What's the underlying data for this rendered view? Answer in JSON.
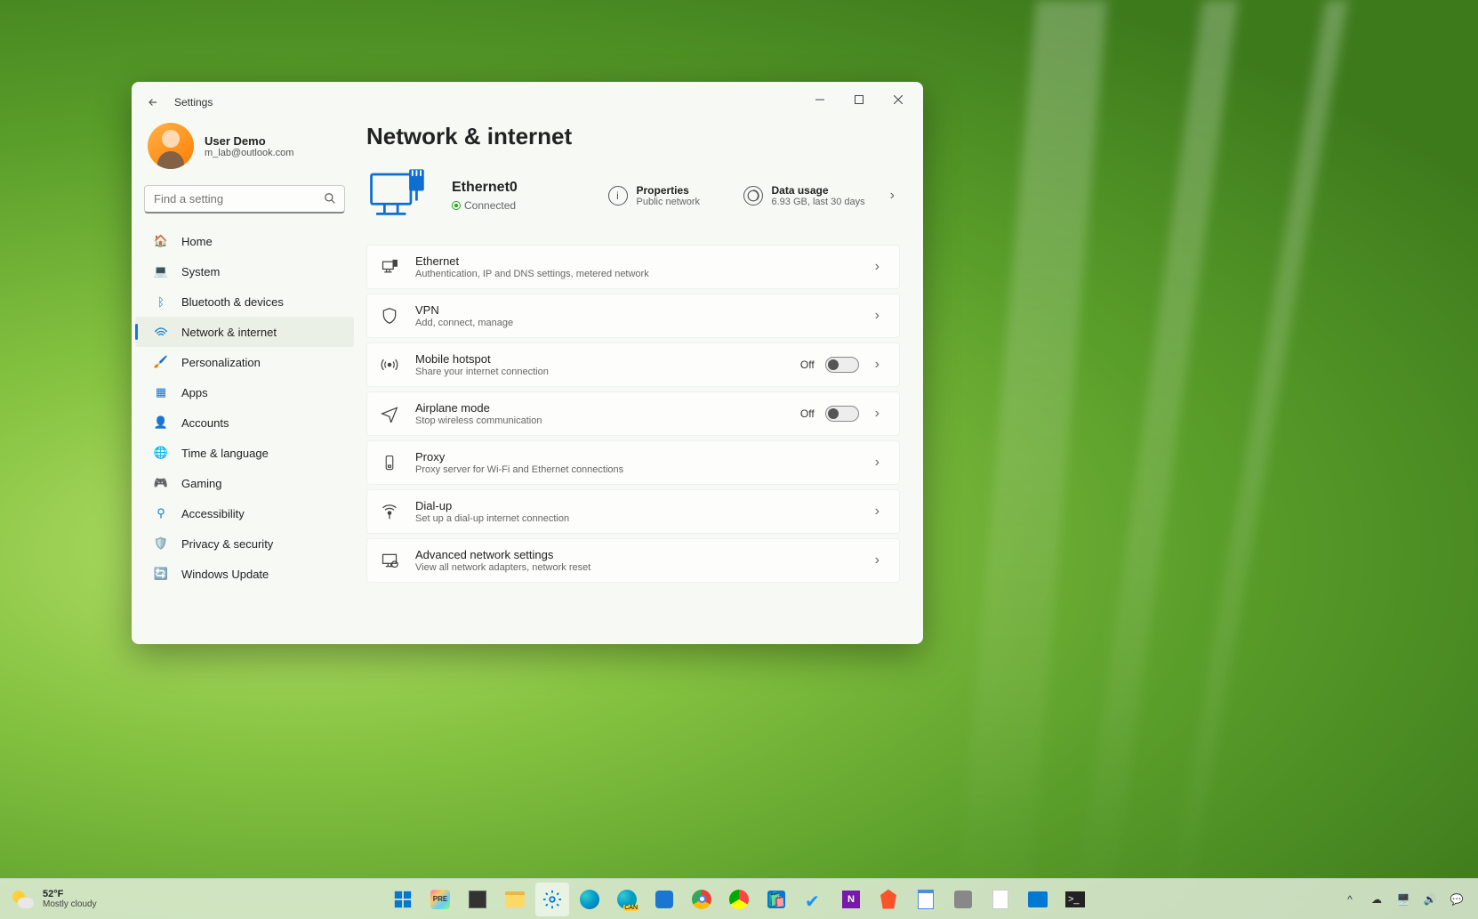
{
  "window": {
    "title": "Settings",
    "user_name": "User Demo",
    "user_email": "m_lab@outlook.com",
    "search_placeholder": "Find a setting"
  },
  "sidebar": {
    "items": [
      {
        "label": "Home"
      },
      {
        "label": "System"
      },
      {
        "label": "Bluetooth & devices"
      },
      {
        "label": "Network & internet"
      },
      {
        "label": "Personalization"
      },
      {
        "label": "Apps"
      },
      {
        "label": "Accounts"
      },
      {
        "label": "Time & language"
      },
      {
        "label": "Gaming"
      },
      {
        "label": "Accessibility"
      },
      {
        "label": "Privacy & security"
      },
      {
        "label": "Windows Update"
      }
    ]
  },
  "page": {
    "title": "Network & internet",
    "connection_name": "Ethernet0",
    "connection_status": "Connected",
    "properties_label": "Properties",
    "properties_sub": "Public network",
    "data_usage_label": "Data usage",
    "data_usage_sub": "6.93 GB, last 30 days"
  },
  "cards": [
    {
      "title": "Ethernet",
      "sub": "Authentication, IP and DNS settings, metered network",
      "toggle": null
    },
    {
      "title": "VPN",
      "sub": "Add, connect, manage",
      "toggle": null
    },
    {
      "title": "Mobile hotspot",
      "sub": "Share your internet connection",
      "toggle": "Off"
    },
    {
      "title": "Airplane mode",
      "sub": "Stop wireless communication",
      "toggle": "Off"
    },
    {
      "title": "Proxy",
      "sub": "Proxy server for Wi-Fi and Ethernet connections",
      "toggle": null
    },
    {
      "title": "Dial-up",
      "sub": "Set up a dial-up internet connection",
      "toggle": null
    },
    {
      "title": "Advanced network settings",
      "sub": "View all network adapters, network reset",
      "toggle": null
    }
  ],
  "taskbar": {
    "temp": "52°F",
    "condition": "Mostly cloudy"
  }
}
